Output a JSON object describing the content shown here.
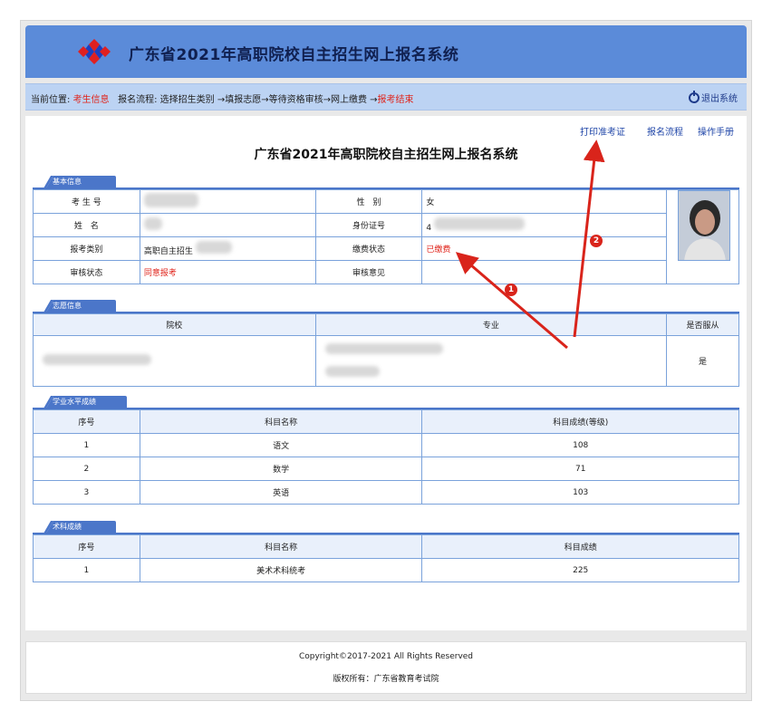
{
  "header": {
    "title": "广东省2021年高职院校自主招生网上报名系统"
  },
  "nav": {
    "location_label": "当前位置:",
    "location_value": "考生信息",
    "process_label": "报名流程: 选择招生类别 →填报志愿→等待资格审核→网上缴费 →",
    "process_last": "报考结束",
    "logout_label": "退出系统"
  },
  "toplinks": {
    "print": "打印准考证",
    "process": "报名流程",
    "manual": "操作手册"
  },
  "page_title": "广东省2021年高职院校自主招生网上报名系统",
  "basic": {
    "tab": "基本信息",
    "rows": [
      {
        "l1": "考 生 号",
        "v1": "",
        "l2": "性　别",
        "v2": "女"
      },
      {
        "l1": "姓　名",
        "v1": "",
        "l2": "身份证号",
        "v2": "4"
      },
      {
        "l1": "报考类别",
        "v1": "高职自主招生",
        "l2": "缴费状态",
        "v2": "已缴费"
      },
      {
        "l1": "审核状态",
        "v1": "同意报考",
        "l2": "审核意见",
        "v2": ""
      }
    ]
  },
  "wish": {
    "tab": "志愿信息",
    "headers": [
      "院校",
      "专业",
      "是否服从"
    ],
    "row": {
      "school": "",
      "major": "",
      "obey": "是"
    }
  },
  "academic": {
    "tab": "学业水平成绩",
    "headers": [
      "序号",
      "科目名称",
      "科目成绩(等级)"
    ],
    "rows": [
      {
        "no": "1",
        "subject": "语文",
        "score": "108"
      },
      {
        "no": "2",
        "subject": "数学",
        "score": "71"
      },
      {
        "no": "3",
        "subject": "英语",
        "score": "103"
      }
    ]
  },
  "skill": {
    "tab": "术科成绩",
    "headers": [
      "序号",
      "科目名称",
      "科目成绩"
    ],
    "rows": [
      {
        "no": "1",
        "subject": "美术术科统考",
        "score": "225"
      }
    ]
  },
  "markers": {
    "one": "1",
    "two": "2"
  },
  "footer": {
    "copyright": "Copyright©2017-2021  All  Rights  Reserved",
    "owner": "版权所有：广东省教育考试院"
  },
  "colors": {
    "header": "#5b8bd9",
    "navbar": "#bcd3f3",
    "accent_red": "#e0241b",
    "section_blue": "#4b76c9"
  }
}
